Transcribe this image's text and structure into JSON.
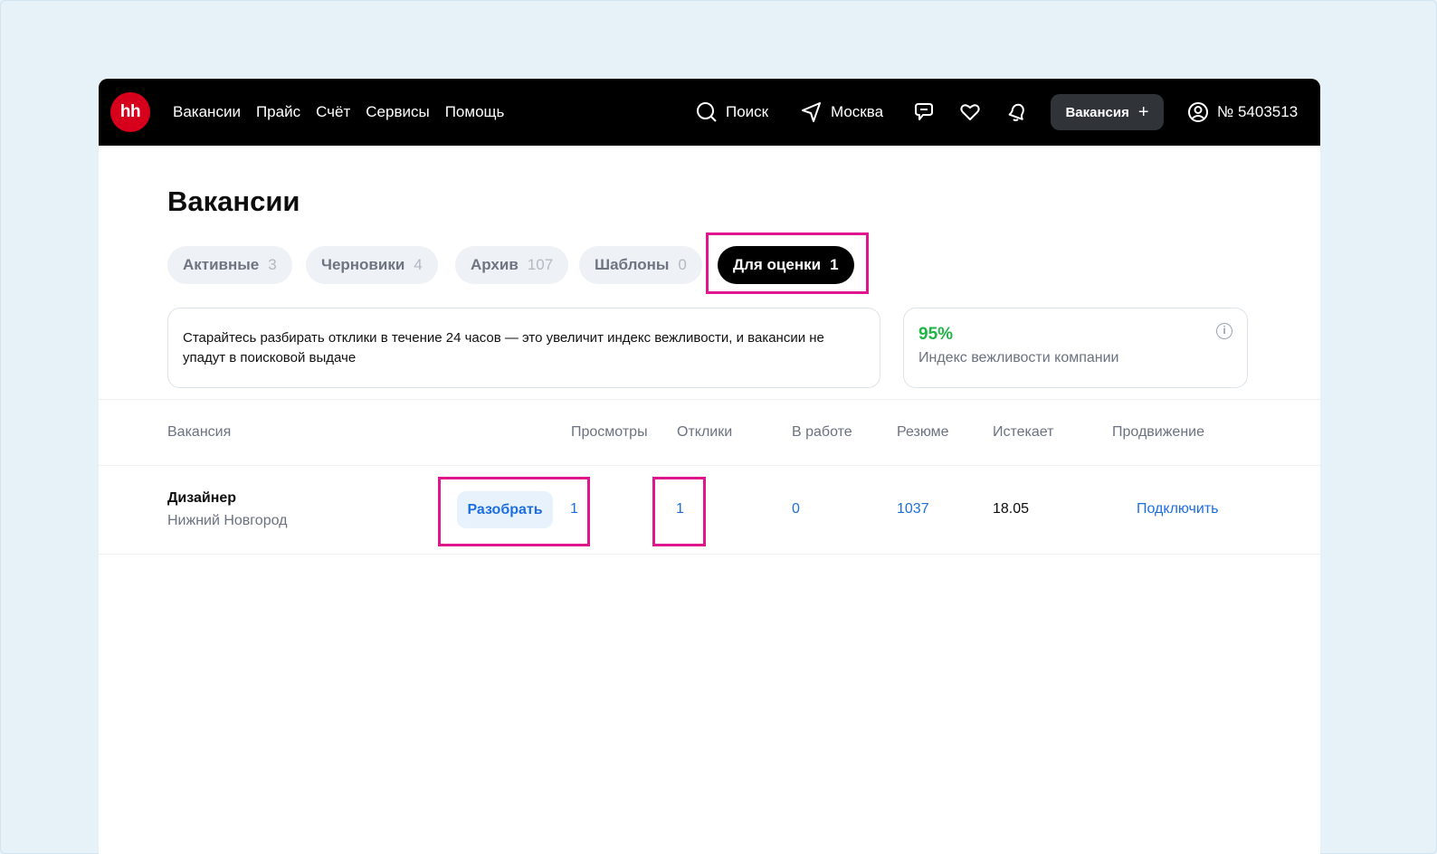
{
  "header": {
    "logo_text": "hh",
    "nav": [
      "Вакансии",
      "Прайс",
      "Счёт",
      "Сервисы",
      "Помощь"
    ],
    "search_label": "Поиск",
    "city_label": "Москва",
    "new_vacancy_label": "Вакансия",
    "new_vacancy_plus": "+",
    "account_label": "№ 5403513"
  },
  "page": {
    "title": "Вакансии",
    "tabs": [
      {
        "label": "Активные",
        "count": "3"
      },
      {
        "label": "Черновики",
        "count": "4"
      },
      {
        "label": "Архив",
        "count": "107"
      },
      {
        "label": "Шаблоны",
        "count": "0"
      },
      {
        "label": "Для оценки",
        "count": "1",
        "active": true
      }
    ],
    "tip_text": "Старайтесь разбирать отклики в течение 24 часов — это увеличит индекс вежливости, и вакансии не упадут в поисковой выдаче",
    "politeness": {
      "value": "95%",
      "label": "Индекс вежливости компании",
      "info_glyph": "i"
    }
  },
  "table": {
    "headers": [
      "Вакансия",
      "Просмотры",
      "Отклики",
      "В работе",
      "Резюме",
      "Истекает",
      "Продвижение"
    ],
    "rows": [
      {
        "title": "Дизайнер",
        "city": "Нижний Новгород",
        "review_label": "Разобрать",
        "views": "1",
        "responses": "1",
        "in_work": "0",
        "resumes": "1037",
        "expires": "18.05",
        "promotion": "Подключить"
      }
    ]
  },
  "colors": {
    "accent": "#1d6fe0",
    "highlight": "#e0168d",
    "success": "#1fb445",
    "brand": "#d6001c"
  }
}
